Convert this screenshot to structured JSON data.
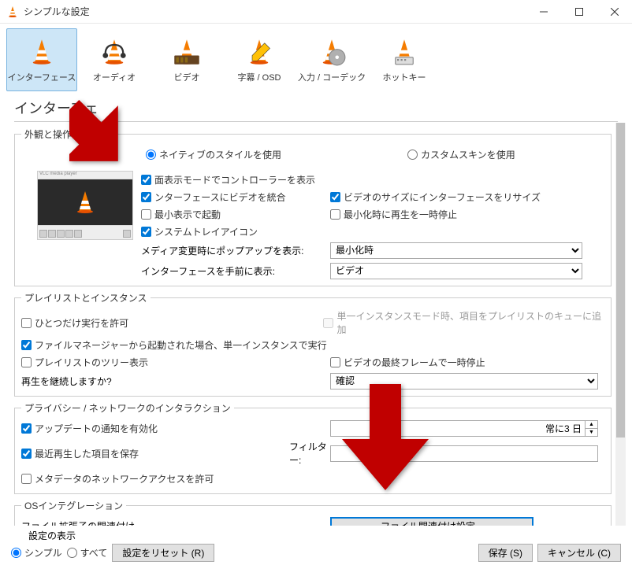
{
  "window": {
    "title": "シンプルな設定"
  },
  "tabs": [
    {
      "label": "インターフェース"
    },
    {
      "label": "オーディオ"
    },
    {
      "label": "ビデオ"
    },
    {
      "label": "字幕 / OSD"
    },
    {
      "label": "入力 / コーデック"
    },
    {
      "label": "ホットキー"
    }
  ],
  "heading": "インターフェ",
  "groups": {
    "appearance": {
      "legend": "外観と操作性",
      "native_style": "ネイティブのスタイルを使用",
      "custom_skin": "カスタムスキンを使用",
      "fullscreen_controller": "面表示モードでコントローラーを表示",
      "integrate_video": "ンターフェースにビデオを統合",
      "resize_interface": "ビデオのサイズにインターフェースをリサイズ",
      "minimal_view": "最小表示で起動",
      "pause_minimize": "最小化時に再生を一時停止",
      "systray": "システムトレイアイコン",
      "media_change_popup": "メディア変更時にポップアップを表示:",
      "raise_interface": "インターフェースを手前に表示:",
      "popup_value": "最小化時",
      "raise_value": "ビデオ"
    },
    "playlist": {
      "legend": "プレイリストとインスタンス",
      "one_instance": "ひとつだけ実行を許可",
      "enqueue": "単一インスタンスモード時、項目をプレイリストのキューに追加",
      "filemanager": "ファイルマネージャーから起動された場合、単一インスタンスで実行",
      "tree_view": "プレイリストのツリー表示",
      "pause_last": "ビデオの最終フレームで一時停止",
      "continue_playback": "再生を継続しますか?",
      "continue_value": "確認"
    },
    "privacy": {
      "legend": "プライバシー / ネットワークのインタラクション",
      "update_notify": "アップデートの通知を有効化",
      "update_days": "常に3 日",
      "save_recent": "最近再生した項目を保存",
      "filter_label": "フィルター:",
      "metadata_network": "メタデータのネットワークアクセスを許可"
    },
    "os": {
      "legend": "OSインテグレーション",
      "file_assoc_label": "ファイル拡張子の関連付け",
      "file_assoc_button": "ファイル関連付け設定..."
    }
  },
  "footer": {
    "show_settings": "設定の表示",
    "simple": "シンプル",
    "all": "すべて",
    "reset": "設定をリセット (R)",
    "save": "保存 (S)",
    "cancel": "キャンセル (C)"
  }
}
